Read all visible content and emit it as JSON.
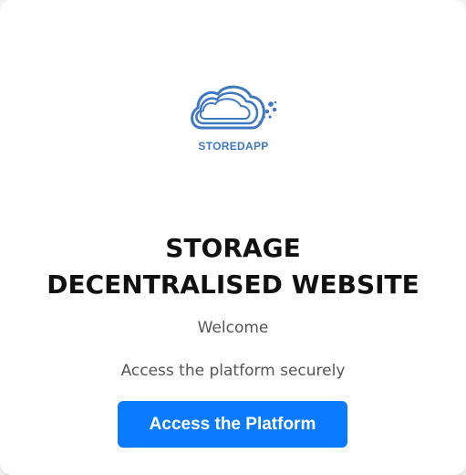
{
  "logo": {
    "brand_text": "STOREDAPP",
    "icon": "cloud-icon",
    "color": "#3f78c2"
  },
  "main": {
    "title_line1": "STORAGE",
    "title_line2": "DECENTRALISED WEBSITE",
    "welcome": "Welcome",
    "subtitle": "Access the platform securely",
    "access_button_label": "Access the Platform"
  },
  "colors": {
    "primary_button": "#0a7bff",
    "background": "#ffffff",
    "title_text": "#111111",
    "secondary_text": "#555555"
  }
}
